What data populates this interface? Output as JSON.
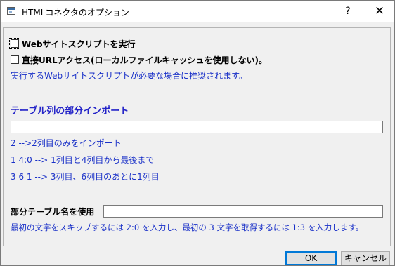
{
  "titlebar": {
    "title": "HTMLコネクタのオプション",
    "help_glyph": "?",
    "close_glyph": "✕"
  },
  "options": {
    "run_scripts_label": "Webサイトスクリプトを実行",
    "run_scripts_checked": false,
    "direct_url_label": "直接URLアクセス(ローカルファイルキャッシュを使用しない)。",
    "direct_url_checked": false,
    "script_note": "実行するWebサイトスクリプトが必要な場合に推奨されます。"
  },
  "partial_columns": {
    "title": "テーブル列の部分インポート",
    "value": "",
    "examples": [
      "2 -->2列目のみをインポート",
      "1 4:0 --> 1列目と4列目から最後まで",
      "3 6 1 --> 3列目、6列目のあとに1列目"
    ]
  },
  "partial_name": {
    "label": "部分テーブル名を使用",
    "value": "",
    "hint": "最初の文字をスキップするには 2:0 を入力し、最初の 3 文字を取得するには 1:3 を入力します。"
  },
  "buttons": {
    "ok": "OK",
    "cancel": "キャンセル"
  },
  "colors": {
    "accent_text": "#1a31c8",
    "default_button_border": "#0078d7",
    "window_bg": "#f0f0f0"
  },
  "icons": {
    "app": "window-icon",
    "help": "help-icon",
    "close": "close-icon"
  }
}
